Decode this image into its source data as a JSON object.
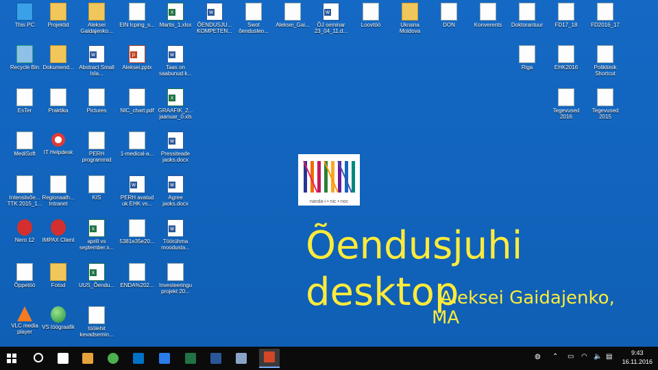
{
  "desktop_icons": [
    {
      "label": "This PC",
      "kind": "pc",
      "icon": "computer-icon"
    },
    {
      "label": "Projektid",
      "kind": "folder",
      "icon": "folder-icon"
    },
    {
      "label": "Aleksei Gaidajenko...",
      "kind": "folder",
      "icon": "user-folder-icon"
    },
    {
      "label": "EIN lcping_s...",
      "kind": "doc",
      "icon": "document-icon"
    },
    {
      "label": "Martis_1.xlsx",
      "kind": "xls",
      "icon": "excel-icon"
    },
    {
      "label": "ÕENDUSJU... KOMPETEN...",
      "kind": "word",
      "icon": "word-icon"
    },
    {
      "label": "Swot õendusleo...",
      "kind": "doc",
      "icon": "document-icon"
    },
    {
      "label": "Aleksei_Gai...",
      "kind": "doc",
      "icon": "image-icon"
    },
    {
      "label": "ÕJ seminar 23_04_11.d...",
      "kind": "word",
      "icon": "word-icon"
    },
    {
      "label": "Loovtöö",
      "kind": "doc",
      "icon": "document-icon"
    },
    {
      "label": "Ukraina Moldova",
      "kind": "folder",
      "icon": "folder-icon"
    },
    {
      "label": "DON",
      "kind": "doc",
      "icon": "document-icon"
    },
    {
      "label": "Konverents",
      "kind": "doc",
      "icon": "document-icon"
    },
    {
      "label": "Doktorantuur",
      "kind": "doc",
      "icon": "document-icon"
    },
    {
      "label": "FD17_18",
      "kind": "doc",
      "icon": "document-icon"
    },
    {
      "label": "FD2016_17",
      "kind": "doc",
      "icon": "document-icon"
    },
    {
      "label": "Recycle Bin",
      "kind": "bin",
      "icon": "recycle-bin-icon"
    },
    {
      "label": "Dokumend...",
      "kind": "folder",
      "icon": "folder-icon"
    },
    {
      "label": "Abstract Small Isla...",
      "kind": "word",
      "icon": "word-icon"
    },
    {
      "label": "Aleksei.pptx",
      "kind": "ppt",
      "icon": "powerpoint-icon"
    },
    {
      "label": "Taas on saabunud k...",
      "kind": "word",
      "icon": "word-icon"
    },
    {
      "label": "Riga",
      "kind": "doc",
      "icon": "document-icon"
    },
    {
      "label": "EHK2016",
      "kind": "doc",
      "icon": "document-icon"
    },
    {
      "label": "Polikliinik Shortcut",
      "kind": "doc",
      "icon": "document-icon"
    },
    {
      "label": "EsTer",
      "kind": "doc",
      "icon": "document-icon"
    },
    {
      "label": "Praktika",
      "kind": "doc",
      "icon": "document-icon"
    },
    {
      "label": "Pictures",
      "kind": "doc",
      "icon": "pictures-icon"
    },
    {
      "label": "NIC_chart.pdf",
      "kind": "chart",
      "icon": "chart-icon"
    },
    {
      "label": "GRAAFIK_2... jaanuar_0.xls",
      "kind": "xls",
      "icon": "excel-icon"
    },
    {
      "label": "Tegevused 2016",
      "kind": "doc",
      "icon": "document-icon"
    },
    {
      "label": "Tegevused 2015",
      "kind": "doc",
      "icon": "document-icon"
    },
    {
      "label": "MediSoft",
      "kind": "doc",
      "icon": "document-icon"
    },
    {
      "label": "IT Helpdesk",
      "kind": "lifebuoy",
      "icon": "lifebuoy-icon"
    },
    {
      "label": "PERH programmid",
      "kind": "doc",
      "icon": "document-icon"
    },
    {
      "label": "1-medical-a...",
      "kind": "doc",
      "icon": "document-icon"
    },
    {
      "label": "Pressiteade jaoks.docx",
      "kind": "word",
      "icon": "word-icon"
    },
    {
      "label": "Intensiivõe... TTK 2015_1...",
      "kind": "doc",
      "icon": "document-icon"
    },
    {
      "label": "Regionaalh... Intranet",
      "kind": "doc",
      "icon": "intranet-icon"
    },
    {
      "label": "KIS",
      "kind": "doc",
      "icon": "document-icon"
    },
    {
      "label": "PERH avatud uk EHK vs...",
      "kind": "word",
      "icon": "word-icon"
    },
    {
      "label": "Agree jaoks.docx",
      "kind": "word",
      "icon": "word-icon"
    },
    {
      "label": "Nero 12",
      "kind": "red",
      "icon": "nero-icon"
    },
    {
      "label": "IMPAX Client",
      "kind": "red",
      "icon": "impax-icon"
    },
    {
      "label": "aprill vs september.x...",
      "kind": "xls",
      "icon": "excel-icon"
    },
    {
      "label": "5381e35e20...",
      "kind": "doc",
      "icon": "image-icon"
    },
    {
      "label": "Töörühma moodusta...",
      "kind": "word",
      "icon": "word-icon"
    },
    {
      "label": "Õppetöö",
      "kind": "doc",
      "icon": "document-icon"
    },
    {
      "label": "Fotod",
      "kind": "folder",
      "icon": "folder-icon"
    },
    {
      "label": "UUS_Õendu...",
      "kind": "xls",
      "icon": "excel-icon"
    },
    {
      "label": "ENDA%202...",
      "kind": "doc",
      "icon": "document-icon"
    },
    {
      "label": "Investeeringu projekt 20...",
      "kind": "doc",
      "icon": "document-icon"
    },
    {
      "label": "VLC media player",
      "kind": "vlc",
      "icon": "vlc-icon"
    },
    {
      "label": "VS töögraafik",
      "kind": "globe",
      "icon": "globe-icon"
    },
    {
      "label": "töölehit kevadsemin...",
      "kind": "doc",
      "icon": "document-icon"
    }
  ],
  "logo": {
    "text": "nanda-i • nic • noc"
  },
  "slide": {
    "title_line1": "Õendusjuhi",
    "title_line2": "desktop",
    "author_line1": "Aleksei Gaidajenko,",
    "author_line2": "MA"
  },
  "taskbar": {
    "items": [
      "search-icon",
      "task-view-icon",
      "store-icon",
      "chrome-icon",
      "outlook-icon",
      "edge-icon",
      "excel-icon",
      "word-icon",
      "app-icon",
      "powerpoint-icon"
    ],
    "time": "9:43",
    "date": "16.11.2016"
  },
  "colors": {
    "accent_text": "#ffeb3b",
    "desktop_bg": "#1565c0",
    "taskbar_bg": "#0b0b0b"
  }
}
